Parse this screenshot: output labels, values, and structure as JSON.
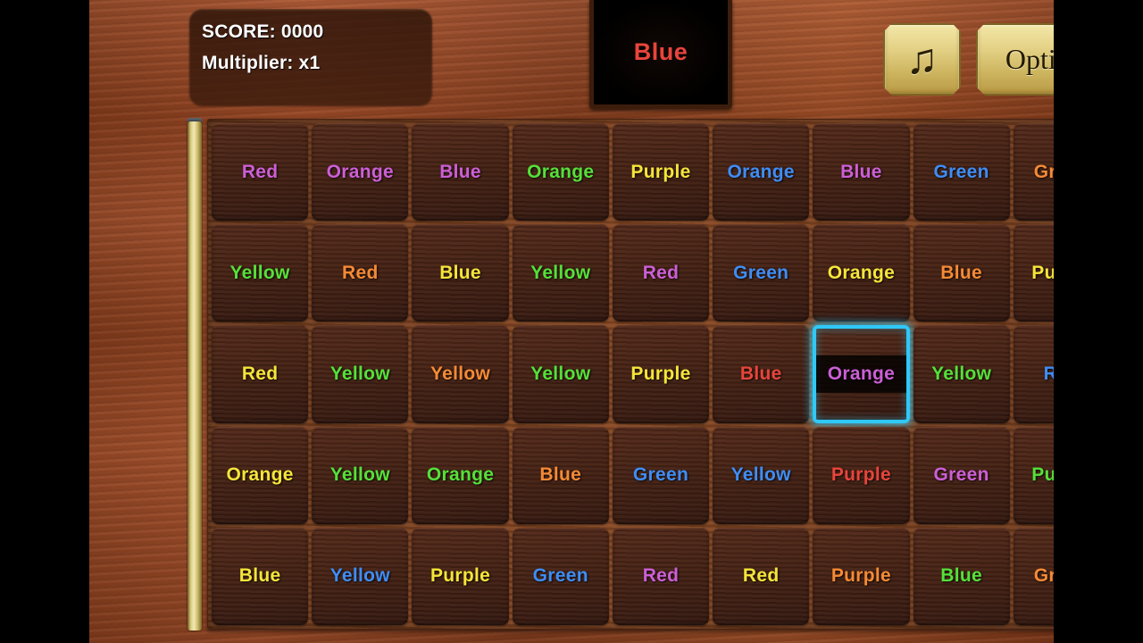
{
  "hud": {
    "score_label": "SCORE: 0000",
    "multiplier_label": "Multiplier: x1"
  },
  "target": {
    "word": "Blue",
    "ink_color": "#e8453c"
  },
  "buttons": {
    "music_icon": "music-note-icon",
    "music_glyph": "♫",
    "options_label": "Options"
  },
  "palette": {
    "red": "#e8453c",
    "orange": "#f58a35",
    "yellow": "#f5e53a",
    "green": "#55e03a",
    "blue": "#3f8df5",
    "purple": "#cc5fd6",
    "selection_border": "#2fc8f7",
    "board_wood": "#8a4a24",
    "tile_wood": "#462214",
    "gold": "#e2cf82"
  },
  "board": {
    "rows": 5,
    "columns": 9,
    "selected_row": 2,
    "selected_column": 6,
    "tiles": [
      [
        {
          "word": "Red",
          "color": "#cc5fd6"
        },
        {
          "word": "Orange",
          "color": "#cc5fd6"
        },
        {
          "word": "Blue",
          "color": "#cc5fd6"
        },
        {
          "word": "Orange",
          "color": "#55e03a"
        },
        {
          "word": "Purple",
          "color": "#f5e53a"
        },
        {
          "word": "Orange",
          "color": "#3f8df5"
        },
        {
          "word": "Blue",
          "color": "#cc5fd6"
        },
        {
          "word": "Green",
          "color": "#3f8df5"
        },
        {
          "word": "Green",
          "color": "#f58a35"
        }
      ],
      [
        {
          "word": "Yellow",
          "color": "#55e03a"
        },
        {
          "word": "Red",
          "color": "#f58a35"
        },
        {
          "word": "Blue",
          "color": "#f5e53a"
        },
        {
          "word": "Yellow",
          "color": "#55e03a"
        },
        {
          "word": "Red",
          "color": "#cc5fd6"
        },
        {
          "word": "Green",
          "color": "#3f8df5"
        },
        {
          "word": "Orange",
          "color": "#f5e53a"
        },
        {
          "word": "Blue",
          "color": "#f58a35"
        },
        {
          "word": "Purple",
          "color": "#f5e53a"
        }
      ],
      [
        {
          "word": "Red",
          "color": "#f5e53a"
        },
        {
          "word": "Yellow",
          "color": "#55e03a"
        },
        {
          "word": "Yellow",
          "color": "#f58a35"
        },
        {
          "word": "Yellow",
          "color": "#55e03a"
        },
        {
          "word": "Purple",
          "color": "#f5e53a"
        },
        {
          "word": "Blue",
          "color": "#e8453c"
        },
        {
          "word": "Orange",
          "color": "#cc5fd6",
          "selected": true
        },
        {
          "word": "Yellow",
          "color": "#55e03a"
        },
        {
          "word": "Red",
          "color": "#3f8df5"
        }
      ],
      [
        {
          "word": "Orange",
          "color": "#f5e53a"
        },
        {
          "word": "Yellow",
          "color": "#55e03a"
        },
        {
          "word": "Orange",
          "color": "#55e03a"
        },
        {
          "word": "Blue",
          "color": "#f58a35"
        },
        {
          "word": "Green",
          "color": "#3f8df5"
        },
        {
          "word": "Yellow",
          "color": "#3f8df5"
        },
        {
          "word": "Purple",
          "color": "#e8453c"
        },
        {
          "word": "Green",
          "color": "#cc5fd6"
        },
        {
          "word": "Purple",
          "color": "#55e03a"
        }
      ],
      [
        {
          "word": "Blue",
          "color": "#f5e53a"
        },
        {
          "word": "Yellow",
          "color": "#3f8df5"
        },
        {
          "word": "Purple",
          "color": "#f5e53a"
        },
        {
          "word": "Green",
          "color": "#3f8df5"
        },
        {
          "word": "Red",
          "color": "#cc5fd6"
        },
        {
          "word": "Red",
          "color": "#f5e53a"
        },
        {
          "word": "Purple",
          "color": "#f58a35"
        },
        {
          "word": "Blue",
          "color": "#55e03a"
        },
        {
          "word": "Green",
          "color": "#f58a35"
        }
      ]
    ]
  },
  "gauges": {
    "left_gauge_name": "timer-gauge-left",
    "right_gauge_name": "timer-gauge-right"
  }
}
